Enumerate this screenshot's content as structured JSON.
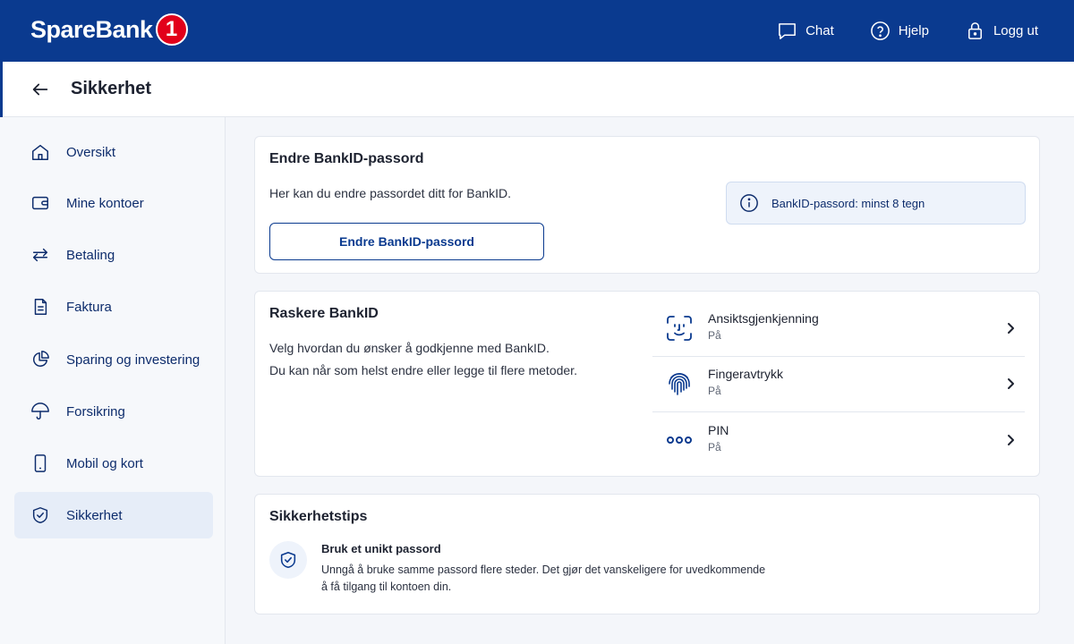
{
  "brand": {
    "name": "SpareBank",
    "badge": "1",
    "primary_color": "#0a3a8f",
    "logo_red": "#e2001a"
  },
  "topbar": {
    "actions": [
      {
        "label": "Chat",
        "icon": "chat-icon"
      },
      {
        "label": "Hjelp",
        "icon": "help-icon"
      },
      {
        "label": "Logg ut",
        "icon": "lock-icon"
      }
    ]
  },
  "header": {
    "title": "Sikkerhet",
    "back_icon": "arrow-left-icon"
  },
  "sidebar": {
    "items": [
      {
        "label": "Oversikt",
        "icon": "home-icon"
      },
      {
        "label": "Mine kontoer",
        "icon": "wallet-icon"
      },
      {
        "label": "Betaling",
        "icon": "transfer-icon"
      },
      {
        "label": "Faktura",
        "icon": "document-icon"
      },
      {
        "label": "Sparing og investering",
        "icon": "pie-chart-icon"
      },
      {
        "label": "Forsikring",
        "icon": "umbrella-icon"
      },
      {
        "label": "Mobil og kort",
        "icon": "phone-icon"
      },
      {
        "label": "Sikkerhet",
        "icon": "shield-icon",
        "active": true
      }
    ]
  },
  "password_card": {
    "title": "Endre BankID-passord",
    "description": "Her kan du endre passordet ditt for BankID.",
    "button_label": "Endre BankID-passord",
    "info_text": "BankID-passord: minst 8 tegn"
  },
  "faster_card": {
    "title": "Raskere BankID",
    "line1": "Velg hvordan du ønsker å godkjenne med BankID.",
    "line2": "Du kan når som helst endre eller legge til flere metoder.",
    "methods": [
      {
        "name": "Ansiktsgjenkjenning",
        "status": "På",
        "icon": "face-id-icon"
      },
      {
        "name": "Fingeravtrykk",
        "status": "På",
        "icon": "fingerprint-icon"
      },
      {
        "name": "PIN",
        "status": "På",
        "icon": "pin-dots-icon"
      }
    ]
  },
  "tips_card": {
    "title": "Sikkerhetstips",
    "tip_title": "Bruk et unikt passord",
    "tip_line1": "Unngå å bruke samme passord flere steder. Det gjør det vanskeligere for uvedkommende",
    "tip_line2": "å få tilgang til kontoen din."
  }
}
